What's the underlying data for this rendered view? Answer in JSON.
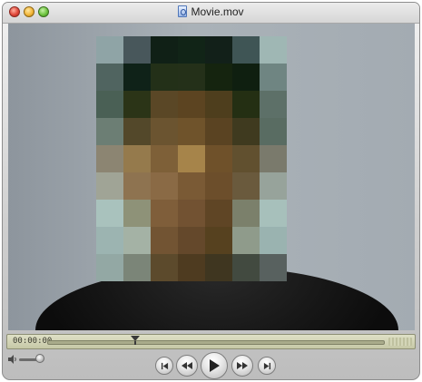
{
  "window": {
    "title": "Movie.mov",
    "file_icon": "quicktime-movie-icon"
  },
  "video": {
    "content": "pixelated-face",
    "pixel_colors": [
      [
        "#8fa4a6",
        "#48575b",
        "#102016",
        "#112417",
        "#122019",
        "#3f5555",
        "#9fb7b4"
      ],
      [
        "#506460",
        "#0f2218",
        "#233018",
        "#243019",
        "#15240f",
        "#0f1f10",
        "#6f8582"
      ],
      [
        "#4a6055",
        "#2b3417",
        "#5a4726",
        "#5c4421",
        "#4e3e1d",
        "#242f13",
        "#5d7068"
      ],
      [
        "#6c7e74",
        "#53482a",
        "#6b5430",
        "#6f532b",
        "#5a4322",
        "#3f3a1f",
        "#596c62"
      ],
      [
        "#8c8572",
        "#957a4c",
        "#7e6038",
        "#a6844a",
        "#6f512a",
        "#61502f",
        "#7a7a6c"
      ],
      [
        "#a0a496",
        "#8e7350",
        "#8a6a45",
        "#7a5a35",
        "#6c4e2b",
        "#6a5a3d",
        "#97a39b"
      ],
      [
        "#a9c2bd",
        "#8e9278",
        "#7f5e3a",
        "#725232",
        "#5f4525",
        "#7b806b",
        "#a7c0bb"
      ],
      [
        "#9cb4b1",
        "#a4b2a5",
        "#725433",
        "#64482b",
        "#56411f",
        "#8f9b8b",
        "#9ab3b0"
      ],
      [
        "#93a8a4",
        "#7b8578",
        "#5c4a2c",
        "#4e3b20",
        "#3f3620",
        "#424a40",
        "#58615f"
      ]
    ]
  },
  "timeline": {
    "timecode": "00:00:00",
    "position_fraction": 0.26
  },
  "volume": {
    "icon": "speaker-icon",
    "level_fraction": 0.9
  },
  "transport": {
    "buttons": [
      "skip-to-start",
      "rewind",
      "play",
      "fast-forward",
      "skip-to-end"
    ]
  }
}
